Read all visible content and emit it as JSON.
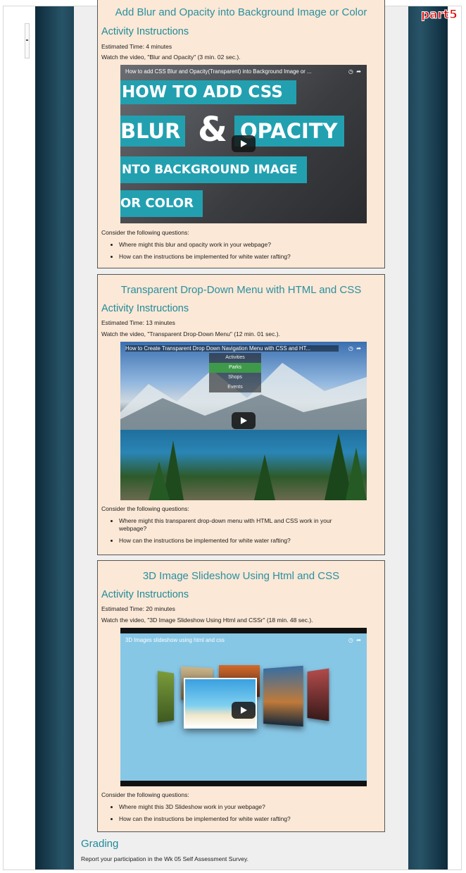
{
  "badge": "part5",
  "sections": [
    {
      "title": "Add Blur and Opacity into Background Image or Color",
      "heading": "Activity Instructions",
      "time": "Estimated Time: 4 minutes",
      "watch": "Watch the video, \"Blur and Opacity\" (3 min. 02 sec.).",
      "video_title": "How to add CSS Blur and Opacity(Transparent) into Background Image or ...",
      "thumb_lines": [
        "HOW TO ADD CSS",
        "BLUR",
        "&",
        "OPACITY",
        "NTO BACKGROUND IMAGE",
        "OR COLOR"
      ],
      "consider": "Consider the following questions:",
      "questions": [
        "Where might this blur and opacity  work in your webpage?",
        "How can the instructions be implemented for white water rafting?"
      ]
    },
    {
      "title": "Transparent Drop-Down Menu with HTML and CSS",
      "heading": "Activity Instructions",
      "time": "Estimated Time: 13 minutes",
      "watch": "Watch the video, \"Transparent  Drop-Down Menu\" (12 min. 01 sec.).",
      "video_title": "How to Create Transparent Drop Down Navigation Menu with CSS and HT...",
      "menu_items": [
        "Activities",
        "Parks",
        "Shops",
        "Events"
      ],
      "consider": "Consider the following questions:",
      "questions": [
        "Where might this transparent drop-down menu with HTML and CSS work in your webpage?",
        "How can the instructions be implemented for white water rafting?"
      ]
    },
    {
      "title": "3D Image Slideshow Using Html and CSS",
      "heading": "Activity Instructions",
      "time": "Estimated Time: 20 minutes",
      "watch": "Watch the video, \"3D Image Slideshow Using Html and CSSr\" (18 min. 48 sec.).",
      "video_title": "3D Images slideshow using html and css",
      "consider": "Consider the following questions:",
      "questions": [
        "Where might this 3D Slideshow  work in your webpage?",
        "How can the instructions be implemented for white water rafting?"
      ]
    }
  ],
  "grading": {
    "heading": "Grading",
    "text": "Report your participation in the Wk 05  Self Assessment Survey."
  },
  "colors": {
    "accent": "#2a8fa0",
    "card_bg": "#fbe8d6",
    "side": "#1f4557",
    "badge": "#e00000"
  },
  "icons": [
    "clock-icon",
    "share-icon",
    "play-icon"
  ]
}
